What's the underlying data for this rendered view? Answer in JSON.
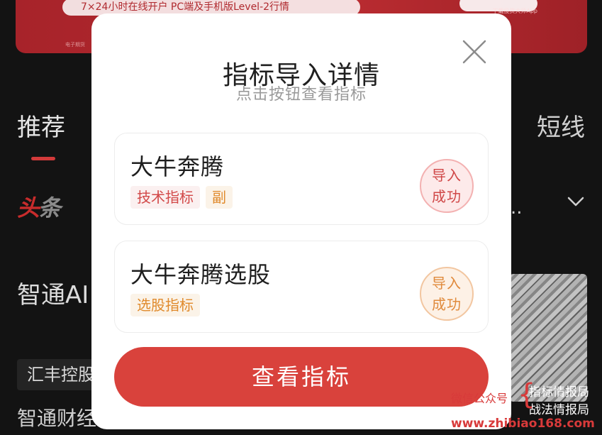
{
  "banner": {
    "promo_text": "7×24小时在线开户  PC端及手机版Level-2行情",
    "note": "下载投资大师App",
    "small": "电子期货"
  },
  "tabs": {
    "recommend": "推荐",
    "short": "短线"
  },
  "feed": {
    "headline_logo_prefix": "头",
    "headline_logo_suffix": "条",
    "ellipsis": "..",
    "news_title": "智通AI",
    "stock_tag": "汇丰控股",
    "news_source": "智通财经"
  },
  "modal": {
    "title": "指标导入详情",
    "subtitle": "点击按钮查看指标",
    "close_icon": "close-icon",
    "cards": [
      {
        "name": "大牛奔腾",
        "tags": [
          "技术指标",
          "副"
        ],
        "status_line1": "导入",
        "status_line2": "成功"
      },
      {
        "name": "大牛奔腾选股",
        "tags": [
          "选股指标"
        ],
        "status_line1": "导入",
        "status_line2": "成功"
      }
    ],
    "view_button": "查看指标"
  },
  "watermark": {
    "account": "微信公众号",
    "line1": "指标情报局",
    "line2": "战法情报局",
    "url": "www.zhibiao168.com"
  },
  "colors": {
    "accent": "#d9423c",
    "tag_red": "#d24848",
    "tag_orange": "#e08a2c",
    "banner": "#b82b30"
  }
}
